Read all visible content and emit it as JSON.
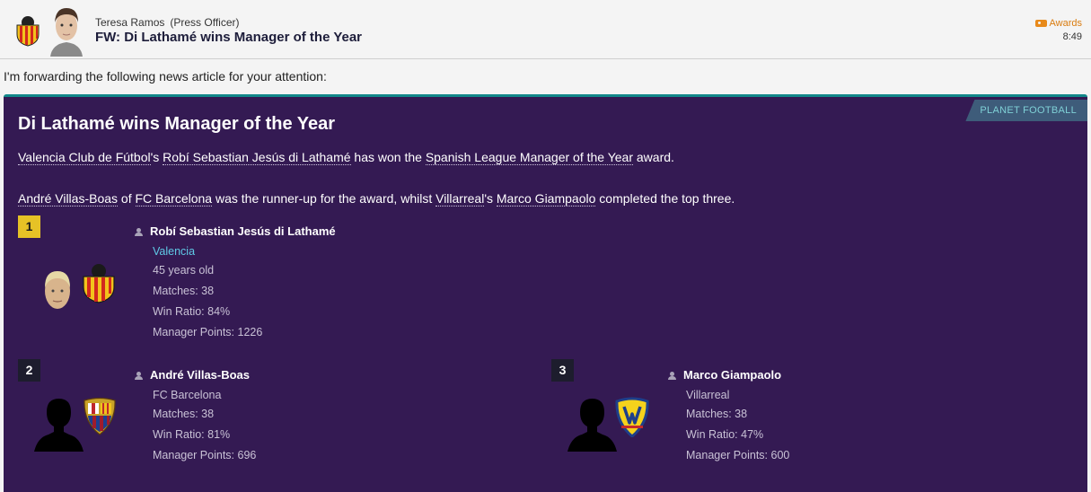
{
  "header": {
    "sender_name": "Teresa Ramos",
    "sender_role": "(Press Officer)",
    "subject": "FW: Di Lathamé wins Manager of the Year",
    "tag": "Awards",
    "time": "8:49",
    "tag_color": "#e88a1a"
  },
  "intro": "I'm forwarding the following news article for your attention:",
  "article": {
    "source": "PLANET FOOTBALL",
    "title": "Di Lathamé wins Manager of the Year",
    "para1": {
      "club": "Valencia Club de Fútbol",
      "possessive": "'s ",
      "manager": "Robí Sebastian Jesús di Lathamé",
      "mid": " has won the ",
      "award": "Spanish League Manager of the Year",
      "end": " award."
    },
    "para2": {
      "runner": "André Villas-Boas",
      "of": " of ",
      "runner_club": "FC Barcelona",
      "mid": " was the runner-up for the award, whilst ",
      "third_club": "Villarreal",
      "possessive": "'s ",
      "third": "Marco Giampaolo",
      "end": " completed the top three."
    },
    "colors": {
      "background": "#341a53",
      "accent": "#12888a",
      "gold": "#e6c226",
      "link": "#5fc9e6"
    },
    "entries": [
      {
        "rank": "1",
        "name": "Robí Sebastian Jesús di Lathamé",
        "club": "Valencia",
        "age": "45 years old",
        "matches": "Matches: 38",
        "win_ratio": "Win Ratio: 84%",
        "points": "Manager Points: 1226"
      },
      {
        "rank": "2",
        "name": "André Villas-Boas",
        "club": "FC Barcelona",
        "matches": "Matches: 38",
        "win_ratio": "Win Ratio: 81%",
        "points": "Manager Points: 696"
      },
      {
        "rank": "3",
        "name": "Marco Giampaolo",
        "club": "Villarreal",
        "matches": "Matches: 38",
        "win_ratio": "Win Ratio: 47%",
        "points": "Manager Points: 600"
      }
    ]
  }
}
